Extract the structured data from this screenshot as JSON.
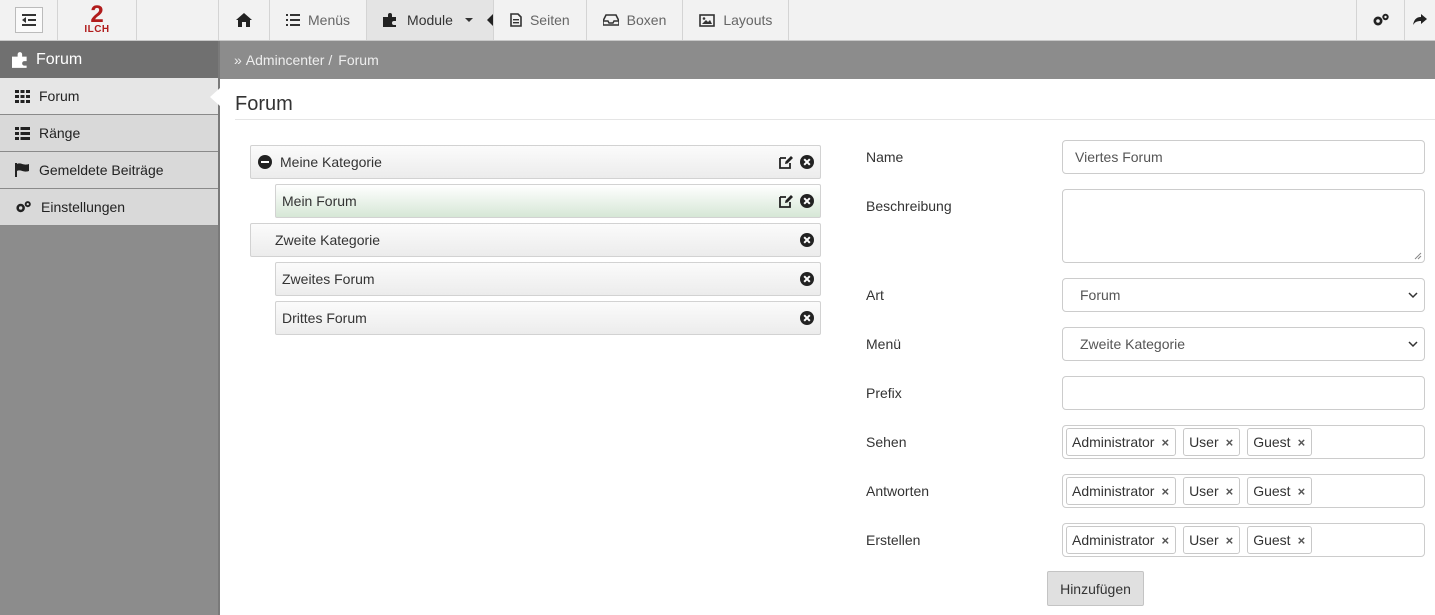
{
  "topbar": {
    "logo_number": "2",
    "logo_text": "ILCH",
    "nav": [
      {
        "label": "Menüs",
        "icon": "list-ol-icon"
      },
      {
        "label": "Module",
        "icon": "puzzle-icon"
      },
      {
        "label": "Seiten",
        "icon": "file-icon"
      },
      {
        "label": "Boxen",
        "icon": "inbox-icon"
      },
      {
        "label": "Layouts",
        "icon": "image-icon"
      }
    ]
  },
  "sidebar": {
    "header": "Forum",
    "items": [
      {
        "label": "Forum",
        "icon": "grid-icon"
      },
      {
        "label": "Ränge",
        "icon": "list-icon"
      },
      {
        "label": "Gemeldete Beiträge",
        "icon": "flag-icon"
      },
      {
        "label": "Einstellungen",
        "icon": "gears-icon"
      }
    ]
  },
  "breadcrumb": {
    "prefix": "»",
    "root": "Admincenter",
    "separator": "/",
    "current": "Forum"
  },
  "page_title": "Forum",
  "tree": [
    {
      "label": "Meine Kategorie",
      "type": "category"
    },
    {
      "label": "Mein Forum",
      "type": "forum"
    },
    {
      "label": "Zweite Kategorie",
      "type": "category"
    },
    {
      "label": "Zweites Forum",
      "type": "forum"
    },
    {
      "label": "Drittes Forum",
      "type": "forum"
    }
  ],
  "form": {
    "name_label": "Name",
    "name_value": "Viertes Forum",
    "description_label": "Beschreibung",
    "description_value": "",
    "type_label": "Art",
    "type_value": "Forum",
    "menu_label": "Menü",
    "menu_value": "Zweite Kategorie",
    "prefix_label": "Prefix",
    "prefix_value": "",
    "view_label": "Sehen",
    "view_roles": [
      "Administrator",
      "User",
      "Guest"
    ],
    "reply_label": "Antworten",
    "reply_roles": [
      "Administrator",
      "User",
      "Guest"
    ],
    "create_label": "Erstellen",
    "create_roles": [
      "Administrator",
      "User",
      "Guest"
    ],
    "remove_symbol": "×",
    "submit_label": "Hinzufügen"
  },
  "colors": {
    "sidebar_bg": "#8c8c8c",
    "brand_red": "#b11c1c",
    "selected_row": "#d6e7d6"
  }
}
